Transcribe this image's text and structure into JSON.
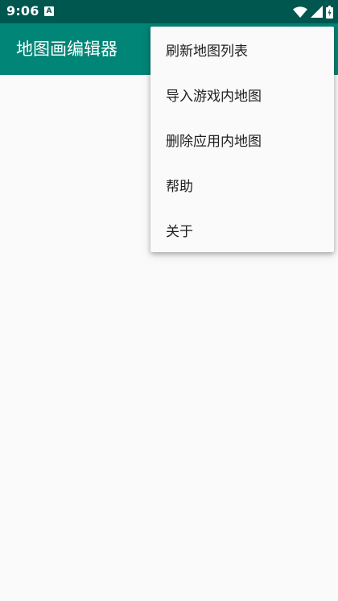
{
  "status_bar": {
    "time": "9:06",
    "notification_icon_letter": "A",
    "icons": [
      "wifi-icon",
      "signal-icon",
      "battery-icon"
    ],
    "colors": {
      "background": "#00574f"
    }
  },
  "app_bar": {
    "title": "地图画编辑器",
    "colors": {
      "background": "#008577"
    }
  },
  "overflow_menu": {
    "items": [
      {
        "label": "刷新地图列表"
      },
      {
        "label": "导入游戏内地图"
      },
      {
        "label": "删除应用内地图"
      },
      {
        "label": "帮助"
      },
      {
        "label": "关于"
      }
    ]
  }
}
